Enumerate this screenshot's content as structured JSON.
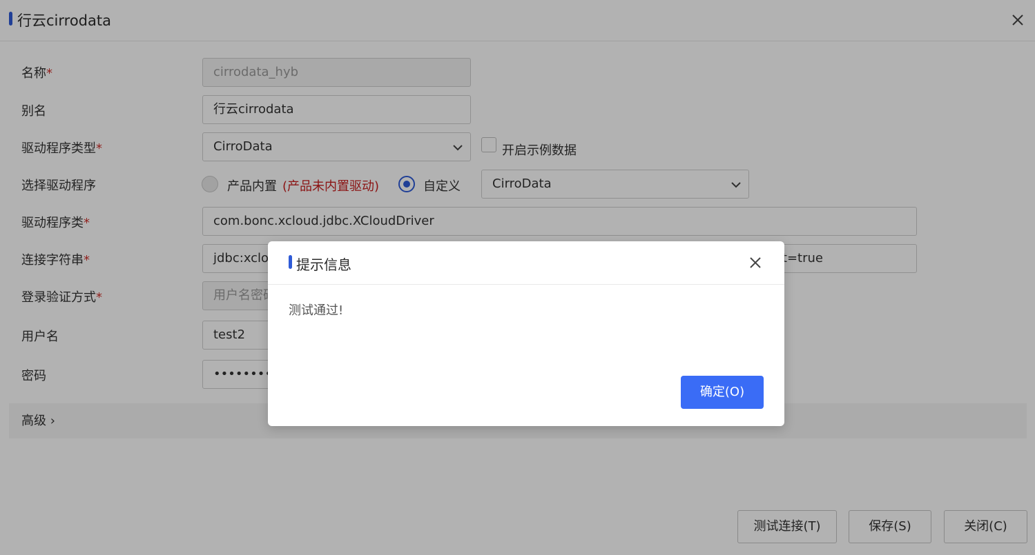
{
  "window": {
    "title": "行云cirrodata"
  },
  "form": {
    "name": {
      "label": "名称",
      "required_mark": "*",
      "value": "cirrodata_hyb"
    },
    "alias": {
      "label": "别名",
      "value": "行云cirrodata"
    },
    "driver_type": {
      "label": "驱动程序类型",
      "required_mark": "*",
      "value": "CirroData",
      "sample_data_label": "开启示例数据"
    },
    "select_driver": {
      "label": "选择驱动程序",
      "option_builtin": "产品内置",
      "builtin_warning": "(产品未内置驱动)",
      "option_custom": "自定义",
      "custom_value": "CirroData",
      "selected": "自定义"
    },
    "driver_class": {
      "label": "驱动程序类",
      "required_mark": "*",
      "value": "com.bonc.xcloud.jdbc.XCloudDriver"
    },
    "connection_string": {
      "label": "连接字符串",
      "required_mark": "*",
      "value_visible_start": "jdbc:xclo",
      "value_visible_end": "ct=true"
    },
    "auth_method": {
      "label": "登录验证方式",
      "required_mark": "*",
      "value_visible": "用户名密码"
    },
    "username": {
      "label": "用户名",
      "value": "test2"
    },
    "password": {
      "label": "密码",
      "value_masked": "••••••••••"
    },
    "advanced": {
      "label": "高级",
      "chevron": "›"
    }
  },
  "footer": {
    "test_button": "测试连接(T)",
    "save_button": "保存(S)",
    "close_button": "关闭(C)"
  },
  "dialog": {
    "title": "提示信息",
    "message": "测试通过!",
    "ok_button": "确定(O)"
  },
  "colors": {
    "accent": "#2f5bd7",
    "primary_button": "#3a6cf6",
    "warning": "#c81d1d",
    "required": "#d0302b"
  }
}
